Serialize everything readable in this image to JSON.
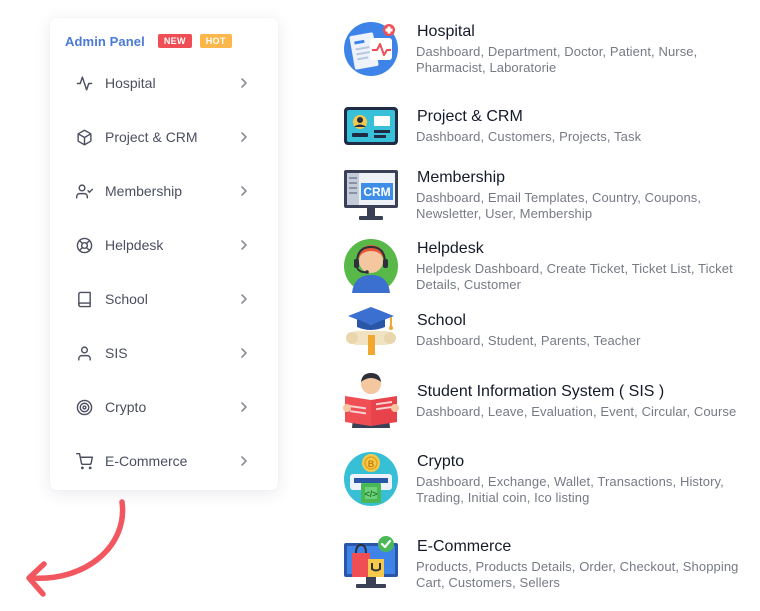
{
  "sidebar": {
    "title": "Admin Panel",
    "badge_new": "NEW",
    "badge_hot": "HOT",
    "items": [
      {
        "label": "Hospital",
        "icon": "activity-icon"
      },
      {
        "label": "Project & CRM",
        "icon": "box-icon"
      },
      {
        "label": "Membership",
        "icon": "user-check-icon"
      },
      {
        "label": "Helpdesk",
        "icon": "lifebuoy-icon"
      },
      {
        "label": "School",
        "icon": "book-icon"
      },
      {
        "label": "SIS",
        "icon": "user-icon"
      },
      {
        "label": "Crypto",
        "icon": "target-icon"
      },
      {
        "label": "E-Commerce",
        "icon": "cart-icon"
      }
    ]
  },
  "modules": [
    {
      "title": "Hospital",
      "desc": "Dashboard, Department, Doctor, Patient, Nurse, Pharmacist, Laboratorie",
      "icon": "hospital-clipboard-icon"
    },
    {
      "title": "Project & CRM",
      "desc": "Dashboard, Customers, Projects, Task",
      "icon": "id-card-icon"
    },
    {
      "title": "Membership",
      "desc": "Dashboard, Email Templates, Country, Coupons, Newsletter, User, Membership",
      "icon": "crm-monitor-icon",
      "icon_text": "CRM"
    },
    {
      "title": "Helpdesk",
      "desc": "Helpdesk Dashboard, Create Ticket, Ticket List, Ticket Details, Customer",
      "icon": "support-agent-icon"
    },
    {
      "title": "School",
      "desc": "Dashboard, Student, Parents, Teacher",
      "icon": "graduation-cap-icon"
    },
    {
      "title": "Student Information System ( SIS )",
      "desc": "Dashboard, Leave, Evaluation, Event, Circular, Course",
      "icon": "student-reading-icon"
    },
    {
      "title": "Crypto",
      "desc": "Dashboard, Exchange, Wallet, Transactions, History, Trading, Initial coin, Ico listing",
      "icon": "crypto-atm-icon"
    },
    {
      "title": "E-Commerce",
      "desc": "Products, Products Details, Order, Checkout, Shopping Cart, Customers, Sellers",
      "icon": "shopping-monitor-icon"
    }
  ],
  "colors": {
    "accent": "#4a7ad8",
    "badge_new": "#ef4e55",
    "badge_hot": "#fbb74a",
    "arrow": "#f2565f"
  }
}
